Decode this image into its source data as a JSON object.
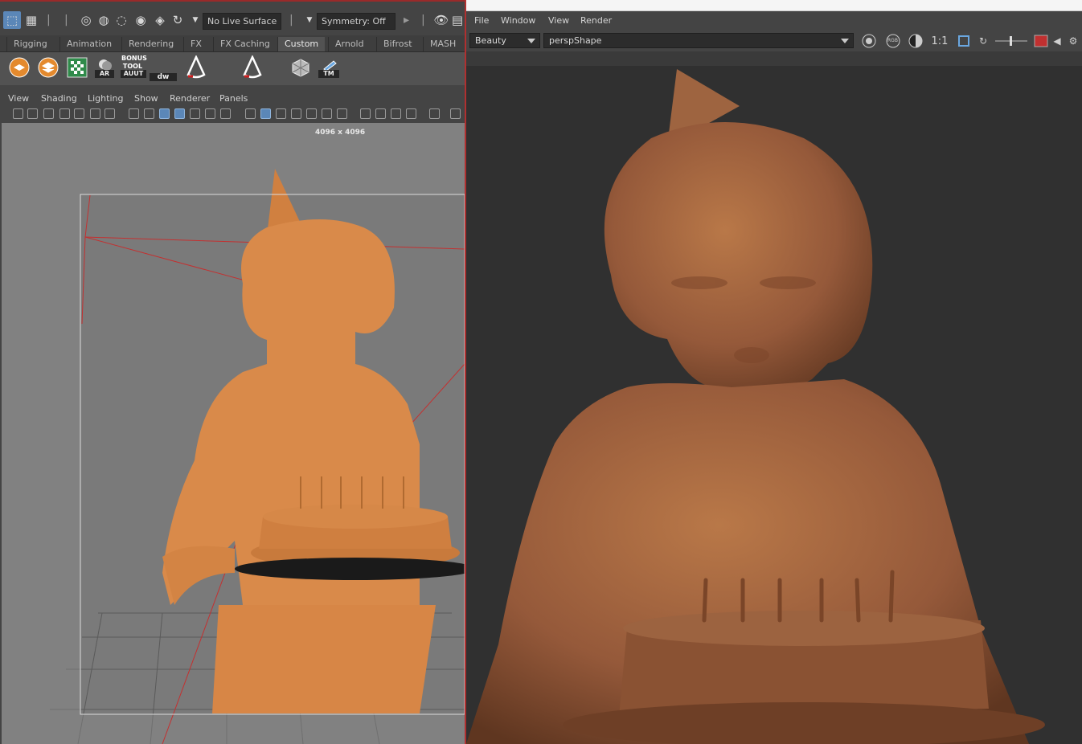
{
  "maya": {
    "status_line": {
      "live_surface": "No Live Surface",
      "symmetry": "Symmetry: Off"
    },
    "shelf_tabs": [
      "Rigging",
      "Animation",
      "Rendering",
      "FX",
      "FX Caching",
      "Custom",
      "Arnold",
      "Bifrost",
      "MASH"
    ],
    "shelf_labels": {
      "ar": "AR",
      "bonus_tool": "BONUS TOOL",
      "auut": "AUUT",
      "dw": "dw",
      "tm": "TM"
    },
    "viewport_menu": [
      "View",
      "Shading",
      "Lighting",
      "Show",
      "Renderer",
      "Panels"
    ],
    "resolution_label": "4096 x 4096"
  },
  "arnold": {
    "menu": [
      "File",
      "Window",
      "View",
      "Render"
    ],
    "aov": "Beauty",
    "camera": "perspShape",
    "zoom": "1:1",
    "rgb_label": "RGB"
  },
  "colors": {
    "clay_viewport": "#d98a4a",
    "clay_render": "#a8693f",
    "accent_blue": "#5b87b8",
    "status_red": "#c03030"
  }
}
